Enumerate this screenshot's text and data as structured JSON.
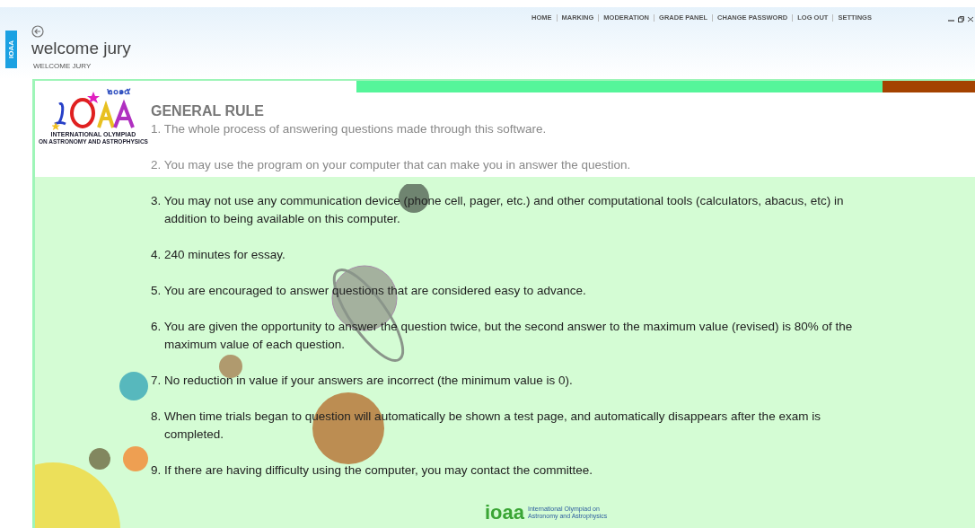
{
  "side_tab": {
    "label": "IOAA"
  },
  "nav": [
    "HOME",
    "MARKING",
    "MODERATION",
    "GRADE PANEL",
    "CHANGE PASSWORD",
    "LOG OUT",
    "SETTINGS"
  ],
  "header": {
    "title": "welcome jury",
    "subtitle": "WELCOME JURY"
  },
  "timer": {
    "level": 0.85
  },
  "logo": {
    "year": "๒๐๑๕",
    "line1": "INTERNATIONAL OLYMPIAD",
    "line2": "ON ASTRONOMY AND ASTROPHYSICS"
  },
  "heading": "GENERAL RULE",
  "rules": [
    {
      "text": "1. The whole process of answering questions made through this software.",
      "muted": true
    },
    {
      "text": "2. You may use the program on your computer that can make you in answer the question.",
      "muted": true
    },
    {
      "text": "3. You may not use any communication device (phone cell, pager, etc.) and other computational tools (calculators, abacus, etc) in addition to being available on this computer.",
      "muted": false
    },
    {
      "text": "4. 240 minutes for essay.",
      "muted": false
    },
    {
      "text": "5. You are encouraged to answer questions that are considered easy to advance.",
      "muted": false
    },
    {
      "text": "6. You are given the opportunity to answer the question twice, but the second answer to the maximum value (revised) is 80% of the maximum value of each question.",
      "muted": false
    },
    {
      "text": "7. No reduction in value if your answers are incorrect (the minimum value is 0).",
      "muted": false
    },
    {
      "text": "8. When time trials began to question will automatically be shown a test page, and automatically disappears after the exam is completed.",
      "muted": false
    },
    {
      "text": "9. If there are having difficulty using the computer, you may contact the committee.",
      "muted": false
    }
  ],
  "footer": {
    "mark": "ioaa",
    "caption": "International Olympiad on Astronomy and Astrophysics"
  }
}
